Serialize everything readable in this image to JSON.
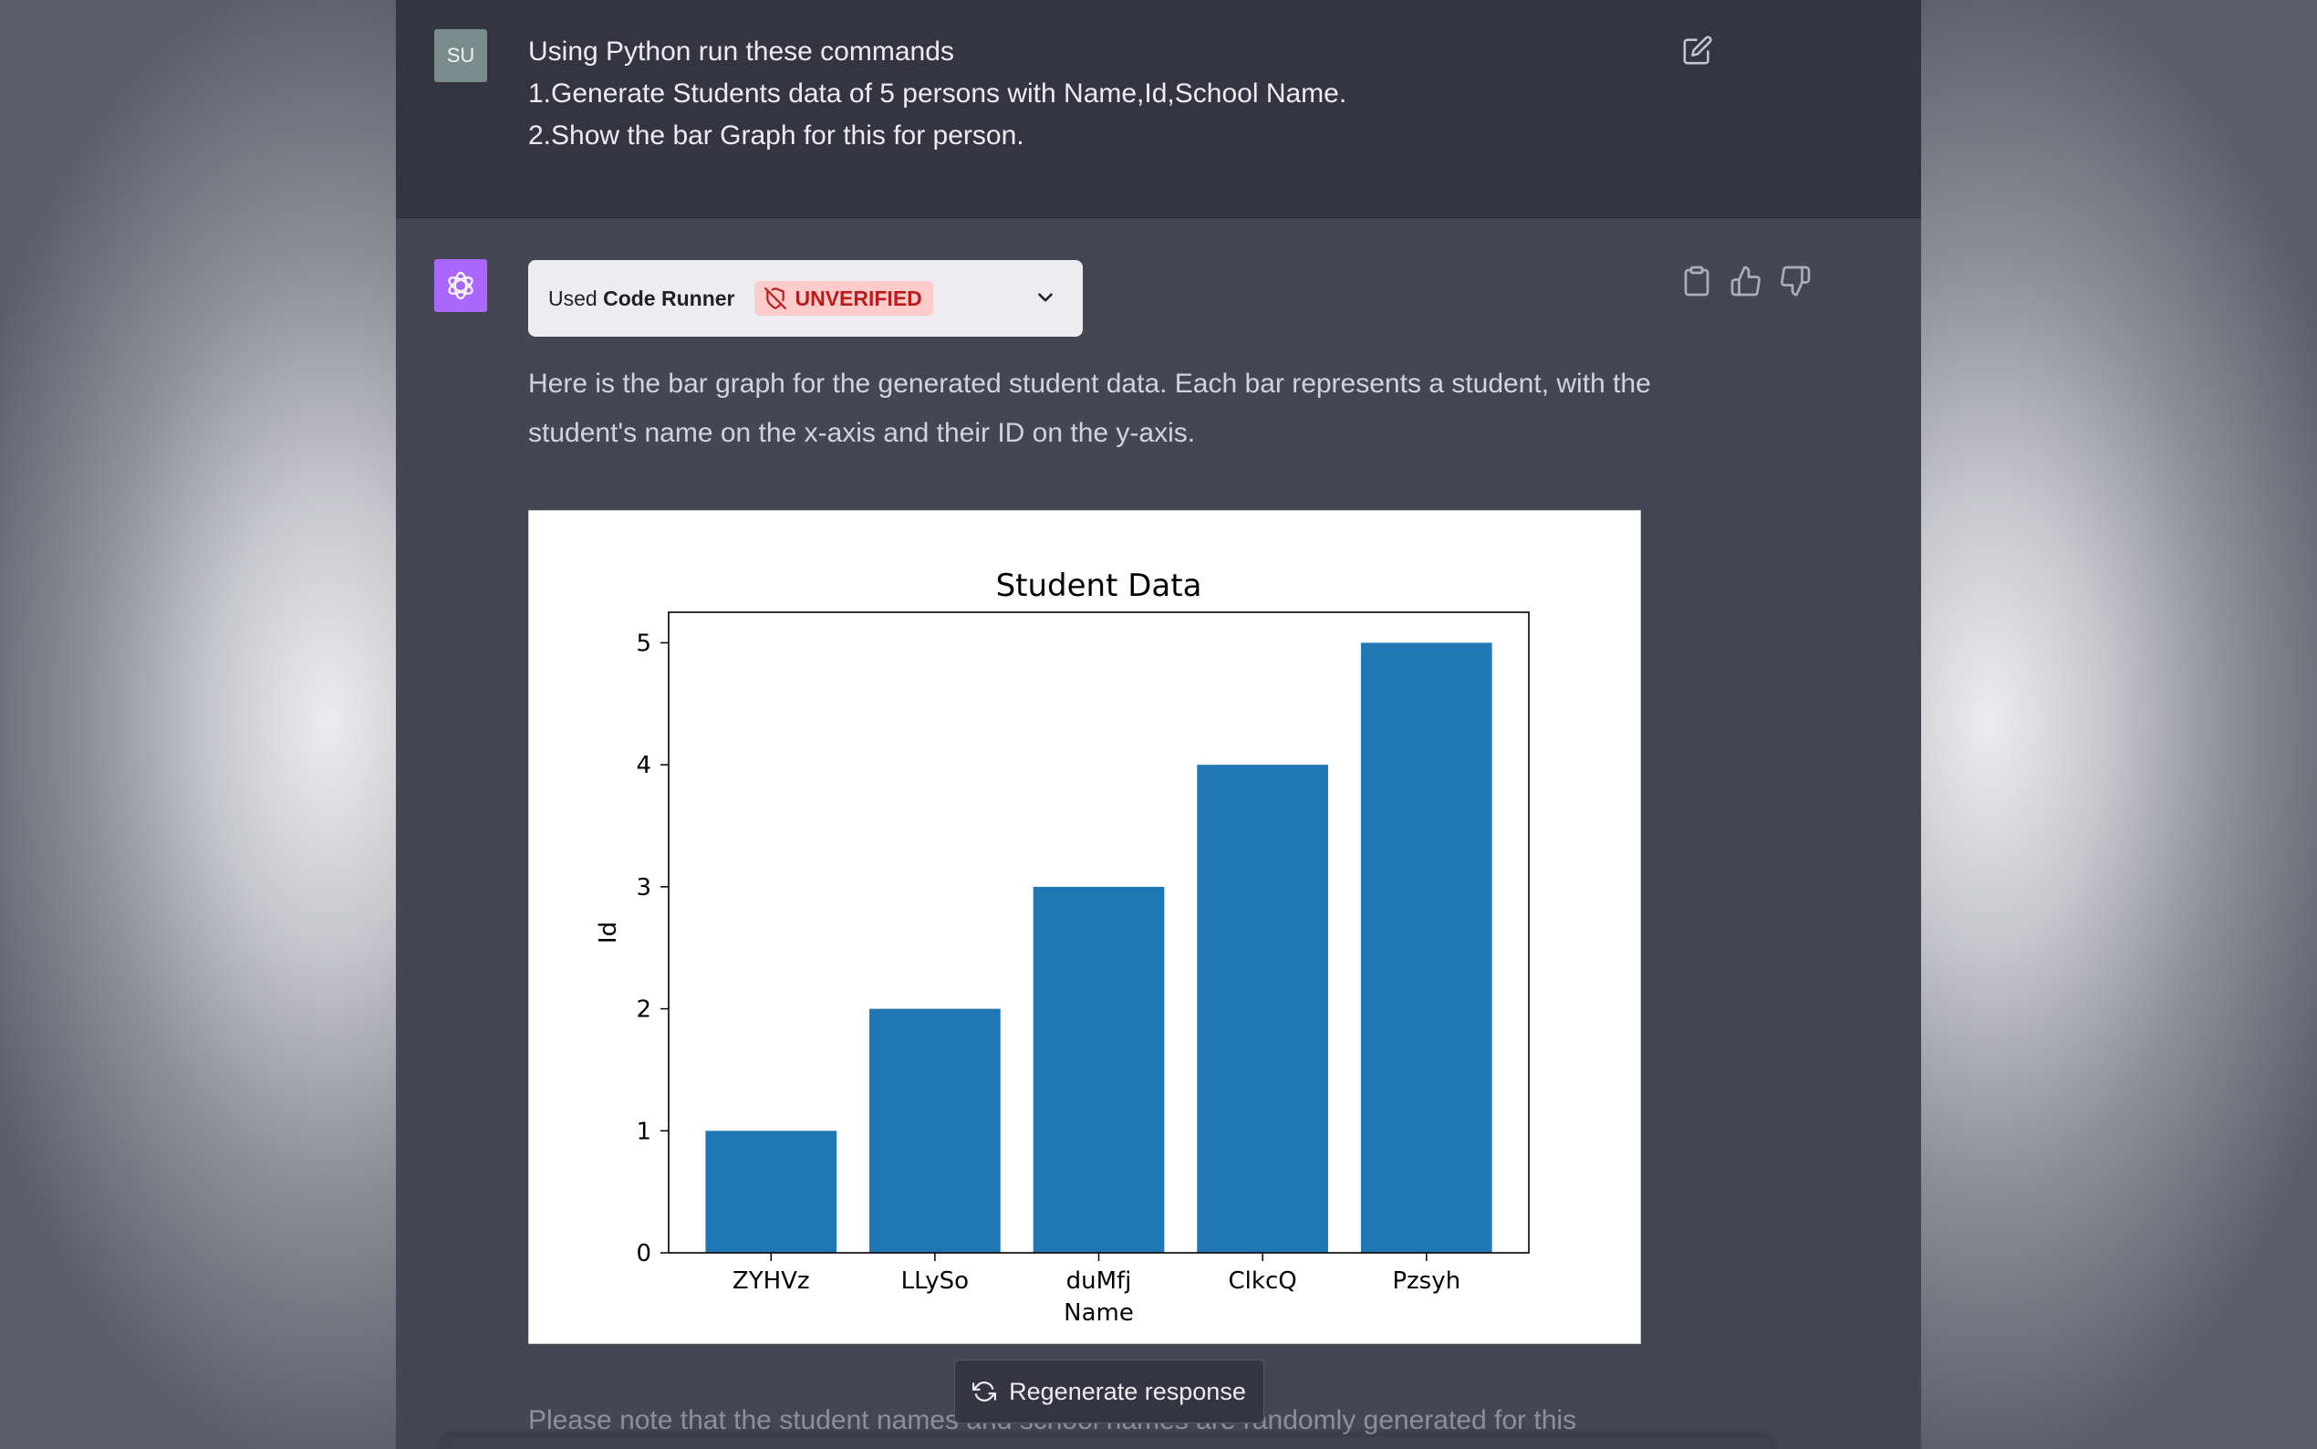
{
  "user_message": {
    "avatar_initials": "SU",
    "lines": [
      "Using Python run these commands",
      "1.Generate Students data of 5 persons with Name,Id,School Name.",
      "2.Show the bar Graph for this for person."
    ]
  },
  "assistant_message": {
    "plugin": {
      "used_prefix": "Used ",
      "plugin_name": "Code Runner",
      "badge": "UNVERIFIED"
    },
    "text_lines": [
      "Here is the bar graph for the generated student data. Each bar represents a student, with the",
      "student's name on the x-axis and their ID on the y-axis."
    ],
    "note_partial": "Please note that the student names and school names are randomly generated for this"
  },
  "regenerate_label": "Regenerate response",
  "colors": {
    "bar": "#1f77b4",
    "assistant_avatar": "#ab68ff",
    "user_avatar": "#7a8c8c",
    "badge_bg": "#fecaca",
    "badge_text": "#b91c1c"
  },
  "chart_data": {
    "type": "bar",
    "title": "Student Data",
    "xlabel": "Name",
    "ylabel": "Id",
    "categories": [
      "ZYHVz",
      "LLySo",
      "duMfj",
      "ClkcQ",
      "Pzsyh"
    ],
    "values": [
      1,
      2,
      3,
      4,
      5
    ],
    "ylim": [
      0,
      5.25
    ],
    "yticks": [
      0,
      1,
      2,
      3,
      4,
      5
    ],
    "grid": false,
    "legend": "none"
  }
}
